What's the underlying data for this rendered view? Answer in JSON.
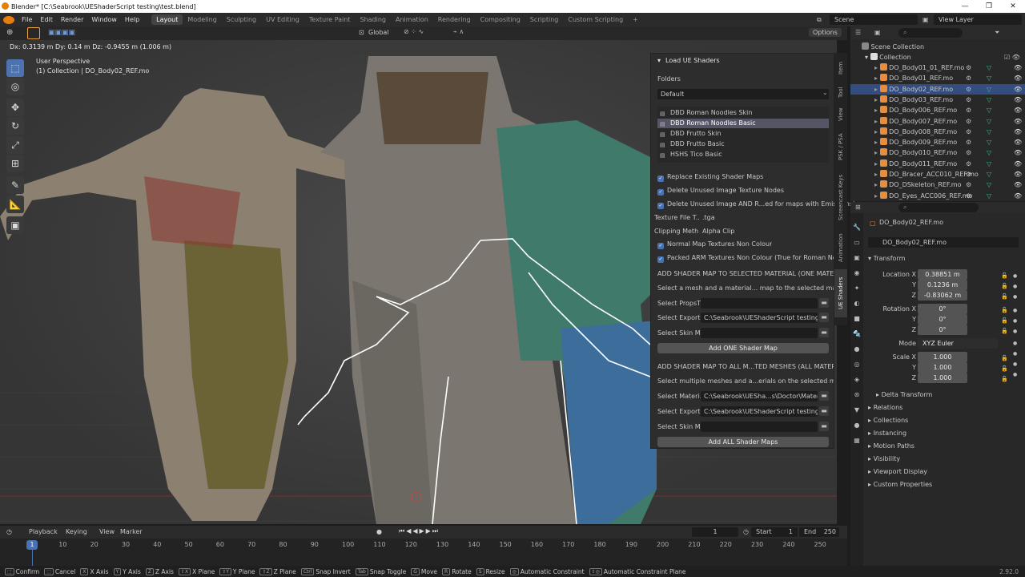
{
  "window": {
    "title": "Blender* [C:\\Seabrook\\UEShaderScript testing\\test.blend]"
  },
  "menu": {
    "items": [
      "File",
      "Edit",
      "Render",
      "Window",
      "Help"
    ]
  },
  "workspaces": [
    "Layout",
    "Modeling",
    "Sculpting",
    "UV Editing",
    "Texture Paint",
    "Shading",
    "Animation",
    "Rendering",
    "Compositing",
    "Scripting",
    "Custom Scripting"
  ],
  "scene": {
    "name": "Scene",
    "view_layer": "View Layer"
  },
  "viewport": {
    "orientation": "Global",
    "options_label": "Options",
    "delta_text": "Dx: 0.3139 m   Dy: 0.14 m   Dz: -0.9455 m (1.006 m)",
    "perspective": "User Perspective",
    "collection_text": "(1) Collection | DO_Body02_REF.mo"
  },
  "ue_panel": {
    "title": "Load UE Shaders",
    "folders_label": "Folders",
    "folder_value": "Default",
    "shader_list": [
      "DBD Roman Noodles Skin",
      "DBD Roman Noodles Basic",
      "DBD Frutto Skin",
      "DBD Frutto Basic",
      "HSHS Tico Basic"
    ],
    "selected_shader": 1,
    "checkboxes": [
      "Replace Existing Shader Maps",
      "Delete Unused Image Texture Nodes",
      "Delete Unused Image AND R...ed for maps with Emissions)"
    ],
    "texture_file_label": "Texture File T...",
    "texture_file_value": ".tga",
    "clipping_label": "Clipping Meth...",
    "clipping_value": "Alpha Clip",
    "checkboxes2": [
      "Normal Map Textures Non Colour",
      "Packed ARM Textures Non Colour (True for Roman Noodle..."
    ],
    "section1_title": "ADD SHADER MAP TO SELECTED MATERIAL (ONE MATERIAL)",
    "section1_desc": "Select a mesh and a material... map to the selected material",
    "s1_fields": [
      {
        "label": "Select PropsT...",
        "value": ""
      },
      {
        "label": "Select Export...",
        "value": "C:\\Seabrook\\UEShaderScript testing\\G..."
      },
      {
        "label": "Select Skin M...",
        "value": ""
      }
    ],
    "button1": "Add ONE Shader Map",
    "section2_title": "ADD SHADER MAP TO ALL M...TED MESHES (ALL MATERIALS)",
    "section2_desc": "Select multiple meshes and a...erials on the selected meshes",
    "s2_fields": [
      {
        "label": "Select Materi...",
        "value": "C:\\Seabrook\\UESha...s\\Doctor\\Materials\\"
      },
      {
        "label": "Select Export...",
        "value": "C:\\Seabrook\\UEShaderScript testing\\G..."
      },
      {
        "label": "Select Skin M...",
        "value": ""
      }
    ],
    "button2": "Add ALL Shader Maps"
  },
  "side_tabs": [
    "Item",
    "Tool",
    "View",
    "PSK / PSA",
    "Screencast Keys",
    "Animation",
    "UE Shaders"
  ],
  "outliner": {
    "root": "Scene Collection",
    "collection": "Collection",
    "items": [
      "DO_Body01_01_REF.mo",
      "DO_Body01_REF.mo",
      "DO_Body02_REF.mo",
      "DO_Body03_REF.mo",
      "DO_Body006_REF.mo",
      "DO_Body007_REF.mo",
      "DO_Body008_REF.mo",
      "DO_Body009_REF.mo",
      "DO_Body010_REF.mo",
      "DO_Body011_REF.mo",
      "DO_Bracer_ACC010_REF.mo",
      "DO_DSkeleton_REF.mo",
      "DO_Eyes_ACC006_REF.mo"
    ],
    "selected": 2
  },
  "properties": {
    "object_name": "DO_Body02_REF.mo",
    "object_field": "DO_Body02_REF.mo",
    "transform_label": "Transform",
    "location_label": "Location X",
    "location": [
      "0.38851 m",
      "0.1236 m",
      "-0.83062 m"
    ],
    "rotation_label": "Rotation X",
    "rotation": [
      "0°",
      "0°",
      "0°"
    ],
    "mode_label": "Mode",
    "mode_value": "XYZ Euler",
    "scale_label": "Scale X",
    "scale": [
      "1.000",
      "1.000",
      "1.000"
    ],
    "axis_y": "Y",
    "axis_z": "Z",
    "delta_transform": "Delta Transform",
    "sections": [
      "Relations",
      "Collections",
      "Instancing",
      "Motion Paths",
      "Visibility",
      "Viewport Display",
      "Custom Properties"
    ]
  },
  "timeline": {
    "menus": [
      "Playback",
      "Keying",
      "View",
      "Marker"
    ],
    "current_frame": "1",
    "start_label": "Start",
    "start": "1",
    "end_label": "End",
    "end": "250",
    "ticks": [
      "10",
      "20",
      "30",
      "40",
      "50",
      "60",
      "70",
      "80",
      "90",
      "100",
      "110",
      "120",
      "130",
      "140",
      "150",
      "160",
      "170",
      "180",
      "190",
      "200",
      "210",
      "220",
      "230",
      "240",
      "250"
    ],
    "playhead": "1"
  },
  "statusbar": {
    "items": [
      "Confirm",
      "Cancel",
      "X Axis",
      "Y Axis",
      "Z Axis",
      "X Plane",
      "Y Plane",
      "Z Plane",
      "Snap Invert",
      "Snap Toggle",
      "Move",
      "Rotate",
      "Resize",
      "Automatic Constraint",
      "Automatic Constraint Plane"
    ],
    "version": "2.92.0"
  },
  "colors": {
    "accent": "#4772b3",
    "selected_row": "#334d80",
    "header": "#2b2b2b",
    "panel": "#2d2d2d"
  }
}
